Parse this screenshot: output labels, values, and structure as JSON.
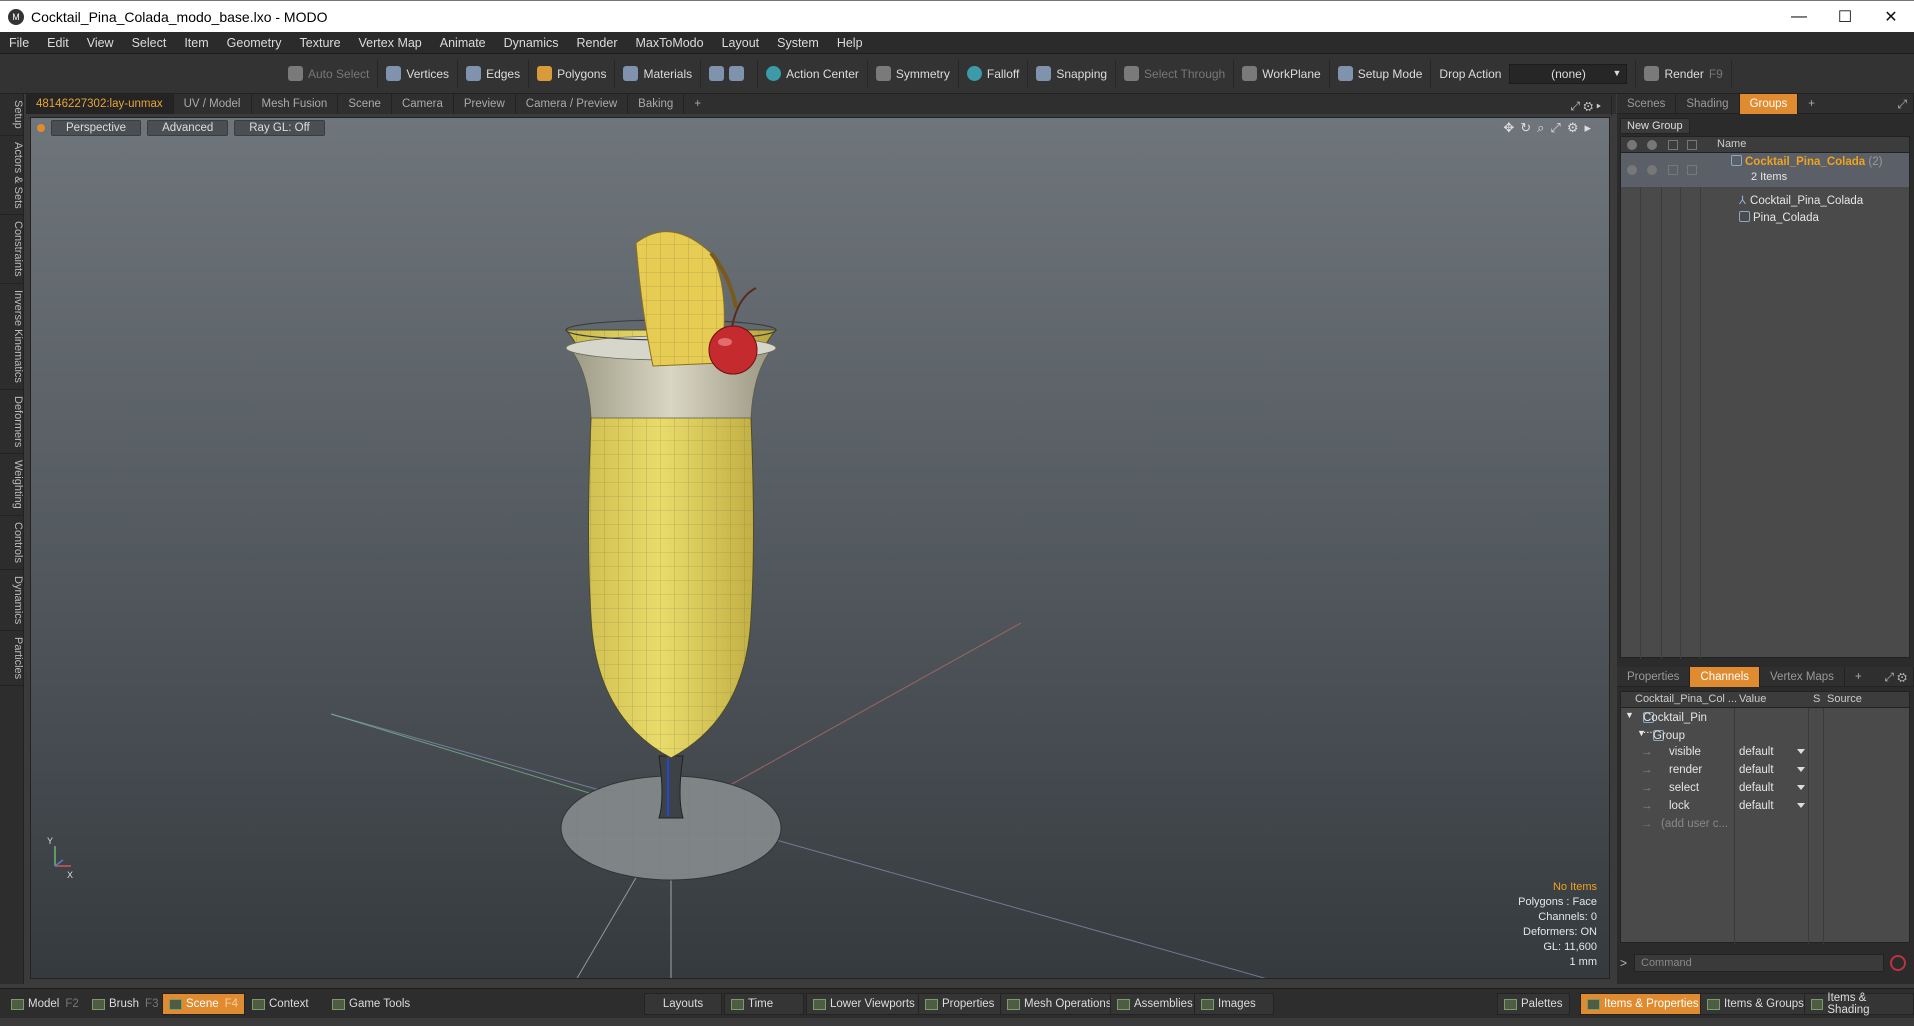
{
  "window": {
    "title": "Cocktail_Pina_Colada_modo_base.lxo - MODO",
    "logo": "M",
    "min": "—",
    "max": "☐",
    "close": "✕"
  },
  "menu": [
    "File",
    "Edit",
    "View",
    "Select",
    "Item",
    "Geometry",
    "Texture",
    "Vertex Map",
    "Animate",
    "Dynamics",
    "Render",
    "MaxToModo",
    "Layout",
    "System",
    "Help"
  ],
  "toolbar": {
    "auto_select": "Auto Select",
    "vertices": "Vertices",
    "edges": "Edges",
    "polygons": "Polygons",
    "materials": "Materials",
    "action_center": "Action Center",
    "symmetry": "Symmetry",
    "falloff": "Falloff",
    "snapping": "Snapping",
    "select_through": "Select Through",
    "workplane": "WorkPlane",
    "setup_mode": "Setup Mode",
    "drop_action": "Drop Action",
    "drop_value": "(none)",
    "render": "Render",
    "render_key": "F9"
  },
  "left_tabs": [
    "Setup",
    "Actors & Sets",
    "Constraints",
    "Inverse Kinematics",
    "Deformers",
    "Weighting",
    "Controls",
    "Dynamics",
    "Particles"
  ],
  "viewport_tabs": [
    "48146227302:lay-unmax",
    "UV / Model",
    "Mesh Fusion",
    "Scene",
    "Camera",
    "Preview",
    "Camera / Preview",
    "Baking",
    "+"
  ],
  "viewport": {
    "view": "Perspective",
    "shading": "Advanced",
    "raygl": "Ray GL: Off",
    "axis_y": "Y",
    "axis_x": "X"
  },
  "info": {
    "items": "No Items",
    "polygons": "Polygons : Face",
    "channels": "Channels: 0",
    "deformers": "Deformers: ON",
    "gl": "GL: 11,600",
    "unit": "1 mm"
  },
  "groups_panel": {
    "tabs": [
      "Scenes",
      "Shading",
      "Groups",
      "+"
    ],
    "new_group": "New Group",
    "name_header": "Name",
    "root": "Cocktail_Pina_Colada",
    "root_count": "(2)",
    "items_count": "2 Items",
    "children": [
      "Cocktail_Pina_Colada",
      "Pina_Colada"
    ]
  },
  "channels_panel": {
    "tabs": [
      "Properties",
      "Channels",
      "Vertex Maps",
      "+"
    ],
    "col_name": "Cocktail_Pina_Col ...",
    "col_value": "Value",
    "col_s": "S",
    "col_source": "Source",
    "item": "Cocktail_Pin ...",
    "group": "Group",
    "rows": [
      {
        "name": "visible",
        "value": "default"
      },
      {
        "name": "render",
        "value": "default"
      },
      {
        "name": "select",
        "value": "default"
      },
      {
        "name": "lock",
        "value": "default"
      }
    ],
    "add_user": "(add user c...",
    "command_placeholder": "Command",
    "prompt": ">"
  },
  "bottom": {
    "model": "Model",
    "model_key": "F2",
    "brush": "Brush",
    "brush_key": "F3",
    "scene": "Scene",
    "scene_key": "F4",
    "context": "Context",
    "game_tools": "Game Tools",
    "layouts": "Layouts",
    "time": "Time",
    "lower_viewports": "Lower Viewports",
    "properties": "Properties",
    "mesh_operations": "Mesh Operations",
    "assemblies": "Assemblies",
    "images": "Images",
    "palettes": "Palettes",
    "items_properties": "Items & Properties",
    "items_groups": "Items & Groups",
    "items_shading": "Items & Shading"
  }
}
